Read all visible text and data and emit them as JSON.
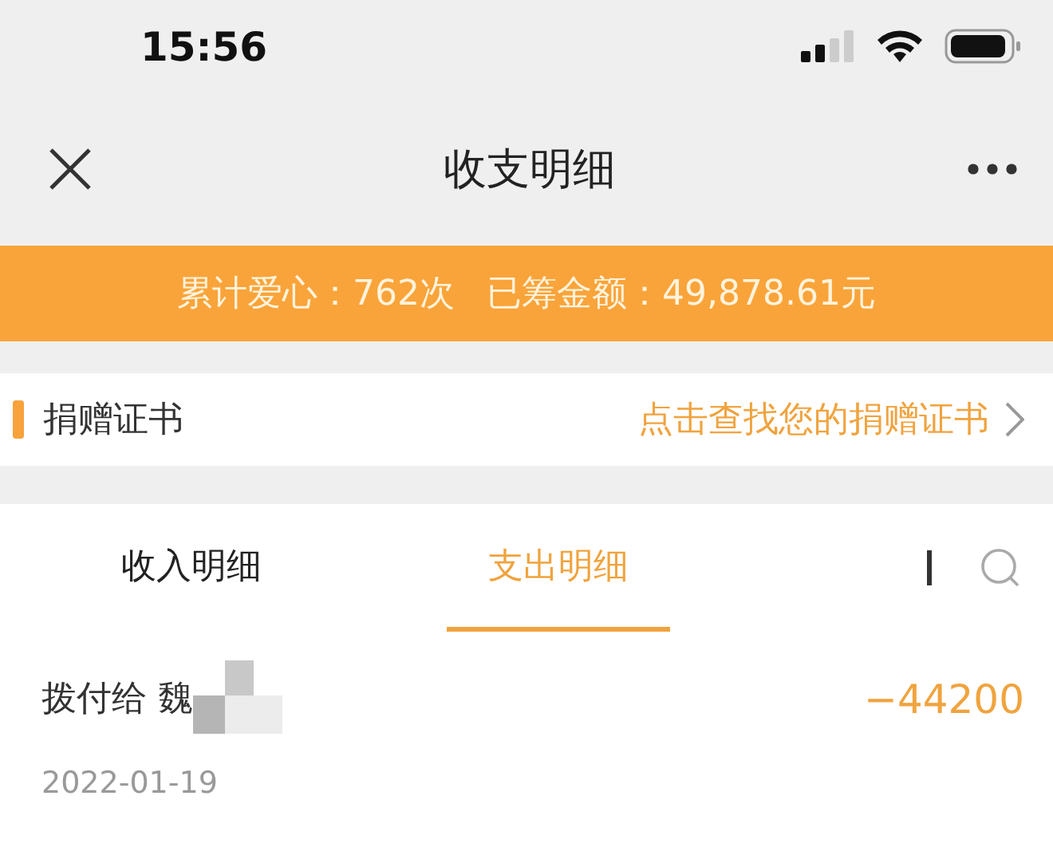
{
  "status_bar": {
    "time": "15:56"
  },
  "nav": {
    "title": "收支明细"
  },
  "summary": {
    "love_label": "累计爱心：",
    "love_count": "762次",
    "raised_label": "已筹金额：",
    "raised_amount": "49,878.61元"
  },
  "certificate": {
    "label": "捐赠证书",
    "link": "点击查找您的捐赠证书"
  },
  "tabs": [
    {
      "label": "收入明细",
      "selected": false
    },
    {
      "label": "支出明细",
      "selected": true
    }
  ],
  "records": [
    {
      "payee": "拨付给 魏",
      "amount": "−44200",
      "date": "2022-01-19",
      "redacted": true
    }
  ]
}
